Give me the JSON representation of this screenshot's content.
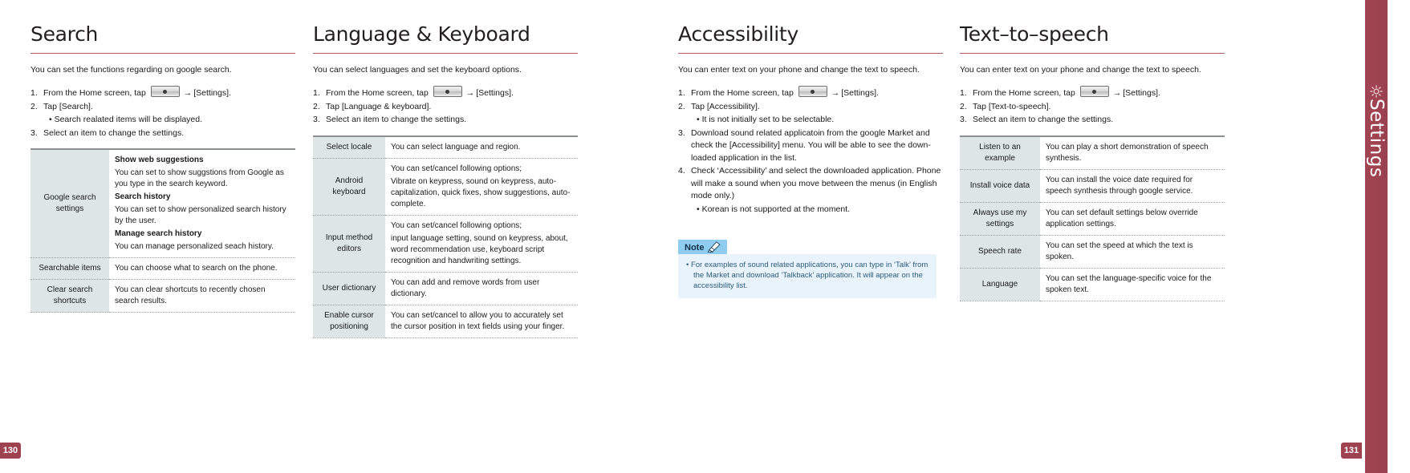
{
  "sections": [
    {
      "title": "Search",
      "intro": "You can set the functions regarding on google search.",
      "steps": [
        {
          "num": "1.",
          "pre": "From the Home screen, tap",
          "post": "[Settings].",
          "has_key": true
        },
        {
          "num": "2.",
          "pre": "Tap [Search].",
          "post": "",
          "has_key": false
        }
      ],
      "sub_bullet": "• Search realated items will be displayed.",
      "step3": {
        "num": "3.",
        "text": "Select an item to change the settings."
      },
      "table": [
        {
          "label": "Google search settings",
          "paras": [
            {
              "bold": "Show web suggestions",
              "text": ""
            },
            {
              "bold": "",
              "text": "You can set to show suggstions from Google as you type in the search keyword."
            },
            {
              "bold": "Search history",
              "text": ""
            },
            {
              "bold": "",
              "text": "You can set to show personalized search history by the user."
            },
            {
              "bold": "Manage search history",
              "text": ""
            },
            {
              "bold": "",
              "text": "You can manage personalized seach history."
            }
          ]
        },
        {
          "label": "Searchable items",
          "paras": [
            {
              "bold": "",
              "text": "You can choose what to search on the phone."
            }
          ]
        },
        {
          "label": "Clear search shortcuts",
          "paras": [
            {
              "bold": "",
              "text": "You can clear shortcuts to recently chosen search results."
            }
          ]
        }
      ]
    },
    {
      "title": "Language & Keyboard",
      "intro": "You can select languages and set the keyboard options.",
      "steps": [
        {
          "num": "1.",
          "pre": "From the Home screen, tap",
          "post": "[Settings].",
          "has_key": true
        },
        {
          "num": "2.",
          "pre": "Tap [Language & keyboard].",
          "post": "",
          "has_key": false
        },
        {
          "num": "3.",
          "pre": "Select an item to change the settings.",
          "post": "",
          "has_key": false
        }
      ],
      "table": [
        {
          "label": "Select locale",
          "paras": [
            {
              "bold": "",
              "text": "You can select language and region."
            }
          ]
        },
        {
          "label": "Android keyboard",
          "paras": [
            {
              "bold": "",
              "text": "You can set/cancel following options;"
            },
            {
              "bold": "",
              "text": "Vibrate on keypress, sound on keypress, auto-capitalization, quick fixes, show suggestions, auto-complete."
            }
          ]
        },
        {
          "label": "Input method editors",
          "paras": [
            {
              "bold": "",
              "text": "You can set/cancel following options;"
            },
            {
              "bold": "",
              "text": "input language setting, sound on keypress, about, word recommendation use, keyboard script recognition and handwriting settings."
            }
          ]
        },
        {
          "label": "User dictionary",
          "paras": [
            {
              "bold": "",
              "text": "You can add and remove words from user dictionary."
            }
          ]
        },
        {
          "label": "Enable cursor positioning",
          "paras": [
            {
              "bold": "",
              "text": "You can set/cancel to allow you to accurately set the cursor position in text fields using your finger."
            }
          ]
        }
      ]
    },
    {
      "title": "Accessibility",
      "intro": "You can enter text on your phone and change the text to speech.",
      "steps": [
        {
          "num": "1.",
          "pre": "From the Home screen, tap",
          "post": "[Settings].",
          "has_key": true
        },
        {
          "num": "2.",
          "pre": "Tap [Accessibility].",
          "post": "",
          "has_key": false
        }
      ],
      "sub_bullet": "• It is not initially set to be selectable.",
      "long_steps": [
        {
          "num": "3.",
          "text": "Download sound related applicatoin from the google Market and check the [Accessibility] menu. You will be able to see the down-loaded application in the list."
        },
        {
          "num": "4.",
          "text": "Check ‘Accessibility’ and select the downloaded application. Phone will make a sound when you move between the menus (in English mode only.)"
        }
      ],
      "last_bullet": "• Korean is not supported at the moment.",
      "note": {
        "label": "Note",
        "body": "• For examples of sound related applications, you can type in ‘Talk’ from the Market and download ‘Talkback’ application. It will appear on the accessibility list."
      }
    },
    {
      "title": "Text–to–speech",
      "intro": "You can enter text on your phone and change the text to speech.",
      "steps": [
        {
          "num": "1.",
          "pre": "From the Home screen, tap",
          "post": "[Settings].",
          "has_key": true
        },
        {
          "num": "2.",
          "pre": "Tap [Text-to-speech].",
          "post": "",
          "has_key": false
        },
        {
          "num": "3.",
          "pre": "Select an item to change the settings.",
          "post": "",
          "has_key": false
        }
      ],
      "table": [
        {
          "label": "Listen to an example",
          "paras": [
            {
              "bold": "",
              "text": "You can play a short demonstration of speech synthesis."
            }
          ]
        },
        {
          "label": "Install voice data",
          "paras": [
            {
              "bold": "",
              "text": "You can install the voice date required for speech synthesis through google service."
            }
          ]
        },
        {
          "label": "Always use my settings",
          "paras": [
            {
              "bold": "",
              "text": "You can set default settings below override application settings."
            }
          ]
        },
        {
          "label": "Speech rate",
          "paras": [
            {
              "bold": "",
              "text": "You can set the speed at which the text is spoken."
            }
          ]
        },
        {
          "label": "Language",
          "paras": [
            {
              "bold": "",
              "text": "You can set the language-specific voice for the spoken text."
            }
          ]
        }
      ]
    }
  ],
  "side_tab": {
    "label": "Settings"
  },
  "page_numbers": {
    "left": "130",
    "right": "131"
  },
  "colors": {
    "accent_red": "#9e4250",
    "rule_red": "#b05a62",
    "table_label_bg": "#dde5e7",
    "note_head_bg": "#8ecdf0",
    "note_body_bg": "#e8f3fb",
    "note_text": "#2b5c7e"
  }
}
